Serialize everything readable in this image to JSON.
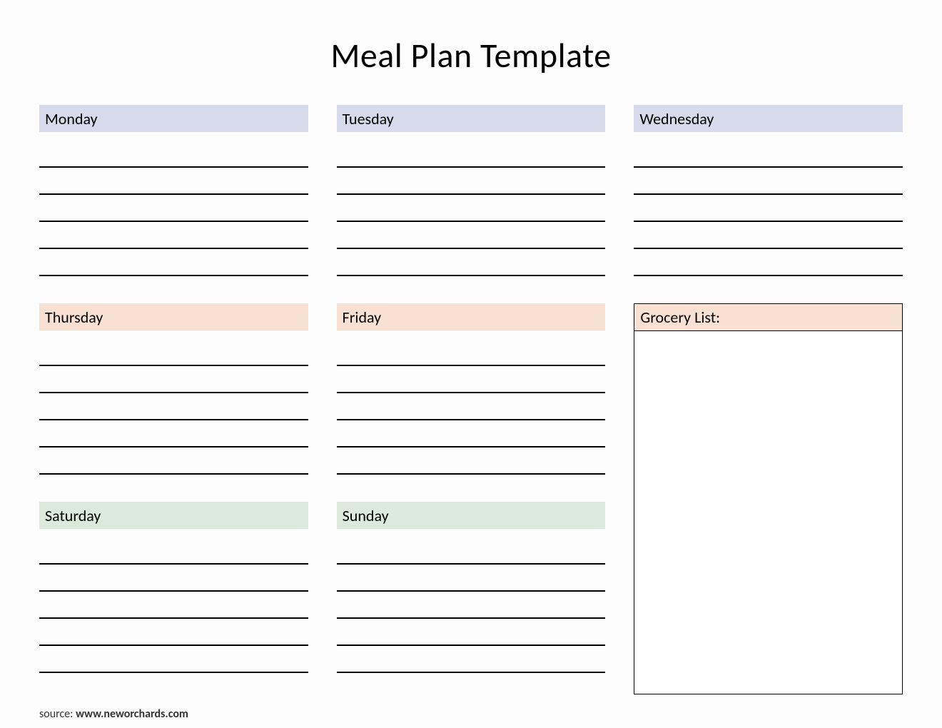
{
  "title": "Meal Plan Template",
  "days": {
    "monday": "Monday",
    "tuesday": "Tuesday",
    "wednesday": "Wednesday",
    "thursday": "Thursday",
    "friday": "Friday",
    "saturday": "Saturday",
    "sunday": "Sunday"
  },
  "grocery_label": "Grocery List:",
  "source": {
    "label": "source: ",
    "url": "www.neworchards.com"
  }
}
